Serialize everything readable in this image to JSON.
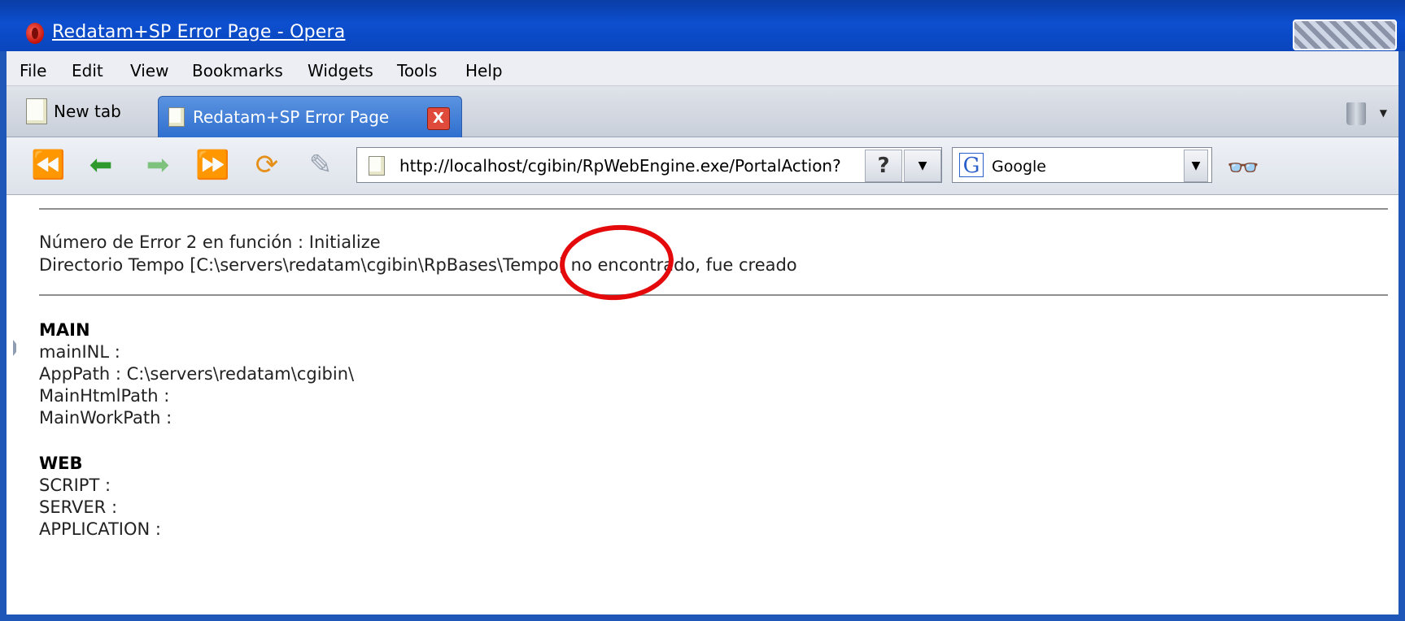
{
  "window": {
    "title": "Redatam+SP Error Page - Opera"
  },
  "menu": [
    "File",
    "Edit",
    "View",
    "Bookmarks",
    "Widgets",
    "Tools",
    "Help"
  ],
  "tabs": {
    "new_tab_label": "New tab",
    "active_tab_label": "Redatam+SP Error Page",
    "close_glyph": "X"
  },
  "toolbar": {
    "icons": [
      "rewind-icon",
      "back-icon",
      "forward-icon",
      "fast-forward-icon",
      "reload-icon",
      "edit-pen-icon"
    ],
    "address": "http://localhost/cgibin/RpWebEngine.exe/PortalAction?",
    "address_help": "?",
    "search_engine": "Google",
    "search_engine_glyph": "G"
  },
  "content": {
    "error_line1": "Número de Error 2 en función : Initialize",
    "error_line2": "Directorio Tempo [C:\\servers\\redatam\\cgibin\\RpBases\\Tempo] no encontrado, fue creado",
    "main_heading": "MAIN",
    "main_items": [
      "mainINL :",
      "AppPath : C:\\servers\\redatam\\cgibin\\",
      "MainHtmlPath :",
      "MainWorkPath :"
    ],
    "web_heading": "WEB",
    "web_items": [
      "SCRIPT :",
      "SERVER :",
      "APPLICATION :"
    ]
  },
  "annotation": {
    "color": "#e4090b"
  },
  "colors": {
    "titlebar": "#0c4fcf",
    "active_tab": "#3f7fdb",
    "frame": "#1f57b8"
  }
}
